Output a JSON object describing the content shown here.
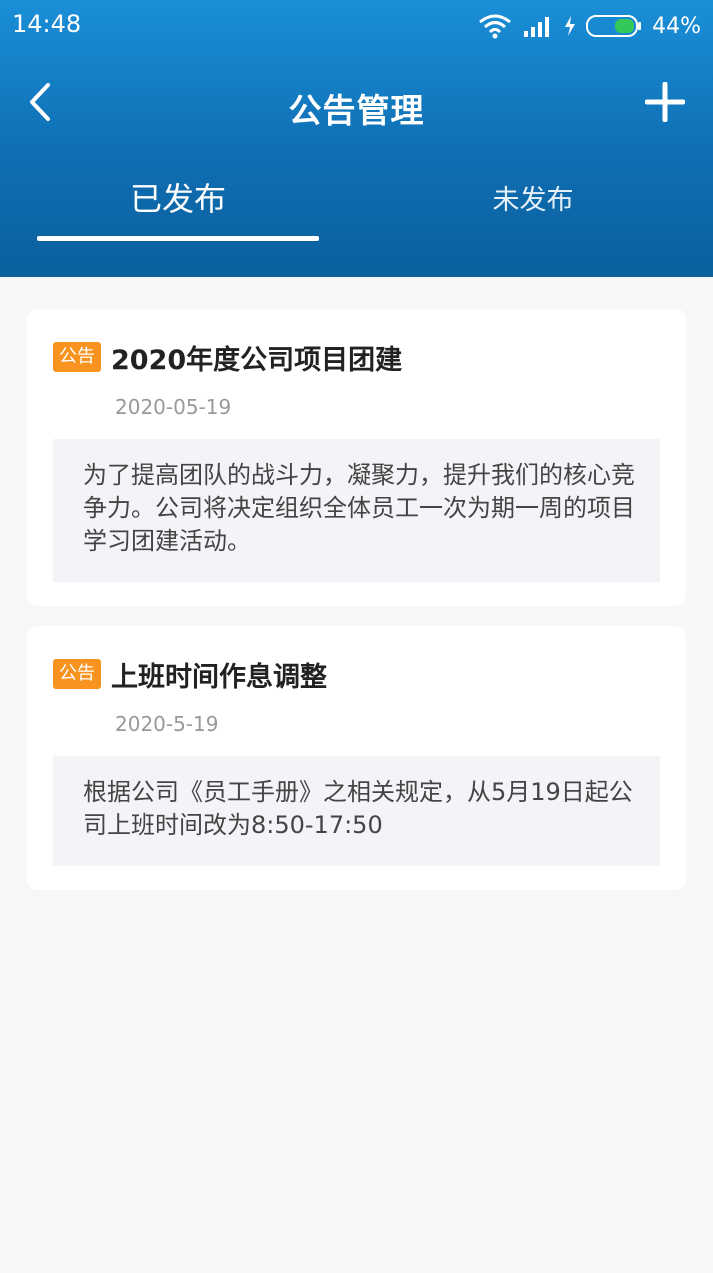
{
  "status_bar": {
    "time": "14:48",
    "battery_percent": "44%",
    "icons": [
      "wifi-icon",
      "signal-icon",
      "charging-icon",
      "battery-icon"
    ]
  },
  "title_bar": {
    "back_icon": "chevron-left-icon",
    "title": "公告管理",
    "add_icon": "plus-icon"
  },
  "tabs": [
    {
      "label": "已发布",
      "active": true
    },
    {
      "label": "未发布",
      "active": false
    }
  ],
  "announcements": [
    {
      "tag": "公告",
      "title": "2020年度公司项目团建",
      "date": "2020-05-19",
      "body": "为了提高团队的战斗力，凝聚力，提升我们的核心竞争力。公司将决定组织全体员工一次为期一周的项目学习团建活动。"
    },
    {
      "tag": "公告",
      "title": "上班时间作息调整",
      "date": "2020-5-19",
      "body": "根据公司《员工手册》之相关规定，从5月19日起公司上班时间改为8:50-17:50"
    }
  ],
  "colors": {
    "header_top": "#1a8fd8",
    "header_bottom": "#0b5f9d",
    "tag_orange": "#f7931e",
    "background": "#f5f7f9",
    "battery_green": "#34c759"
  }
}
